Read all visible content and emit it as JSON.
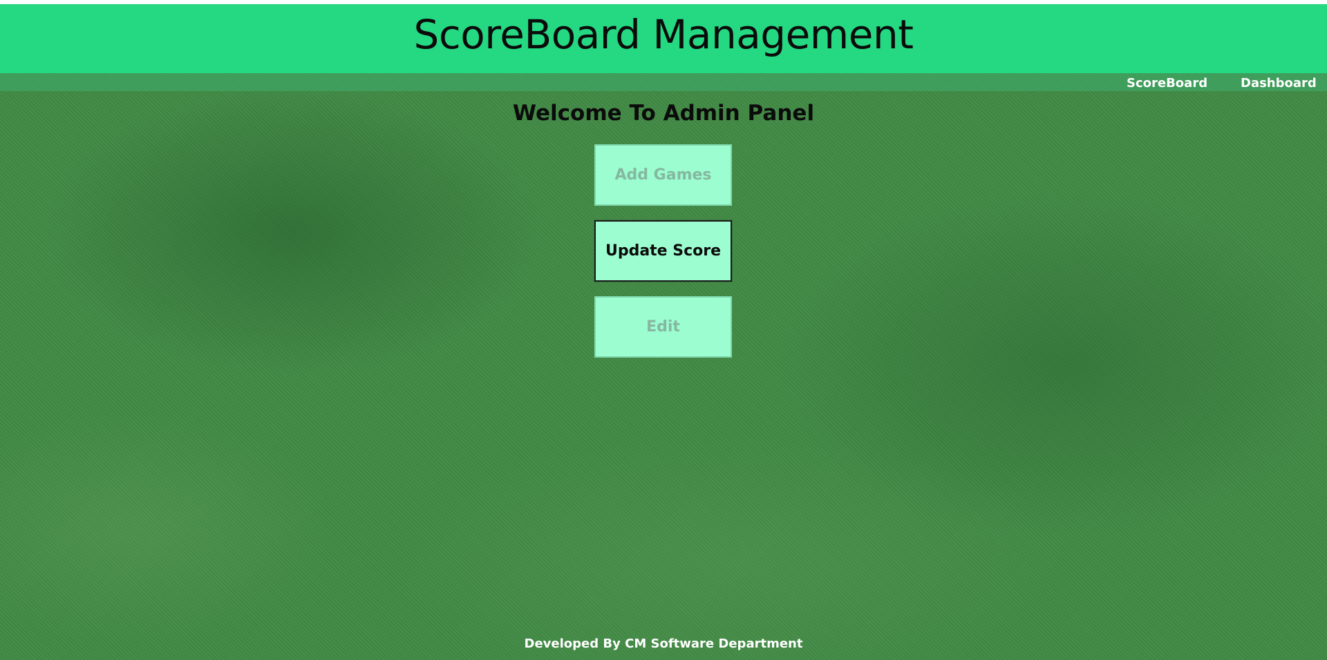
{
  "header": {
    "title": "ScoreBoard Management"
  },
  "nav": {
    "items": [
      {
        "label": "ScoreBoard"
      },
      {
        "label": "Dashboard"
      }
    ]
  },
  "main": {
    "welcome": "Welcome To Admin Panel",
    "buttons": [
      {
        "label": "Add Games",
        "state": "inactive"
      },
      {
        "label": "Update Score",
        "state": "active"
      },
      {
        "label": "Edit",
        "state": "inactive"
      }
    ]
  },
  "footer": {
    "text": "Developed By CM Software Department"
  },
  "colors": {
    "header_bg": "#25d882",
    "button_bg": "#9cfdd0",
    "grass_bg": "#3f8a43"
  }
}
